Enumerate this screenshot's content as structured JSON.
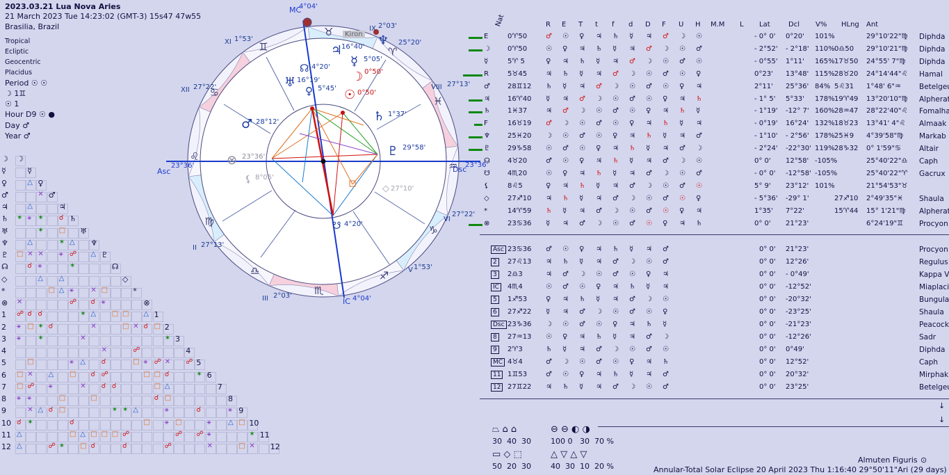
{
  "header": {
    "title": "2023.03.21 Lua Nova Aries",
    "datetime": "21 March 2023  Tue  14:23:02 (GMT-3) 15s47  47w55",
    "place": "Brasilia, Brazil"
  },
  "options": [
    "Tropical",
    "Ecliptic",
    "Geocentric",
    "Placidus"
  ],
  "period": {
    "label": "Period",
    "values": [
      "☉",
      "☉"
    ]
  },
  "moon_line": "☽  1♊",
  "sun_line": "☉   1",
  "hour": {
    "label": "Hour D9",
    "values": [
      "☉",
      "●"
    ]
  },
  "day": {
    "label": "Day",
    "value": "♂"
  },
  "year": {
    "label": "Year",
    "value": "♂"
  },
  "chart": {
    "houses": {
      "mc": "MC",
      "mc_deg": "4°04'",
      "asc": "Asc",
      "asc_deg": "23°36'",
      "dsc": "Dsc",
      "dsc_deg": "23°36'",
      "ic": "IC",
      "ic_deg": "4°04'",
      "cusps": [
        {
          "num": "XI",
          "deg": "1°53'"
        },
        {
          "num": "XII",
          "deg": "27°22'"
        },
        {
          "num": "II",
          "deg": "27°13'"
        },
        {
          "num": "III",
          "deg": "2°03'"
        },
        {
          "num": "VIII",
          "deg": "27°13'"
        },
        {
          "num": "IX",
          "deg": "2°03'"
        },
        {
          "num": "V",
          "deg": "1°53'"
        },
        {
          "num": "VI",
          "deg": "27°22'"
        }
      ]
    },
    "planets": [
      {
        "glyph": "♆",
        "deg": "25°20'",
        "color": "#1a3aa0"
      },
      {
        "glyph": "♃",
        "deg": "16°40'",
        "color": "#1a3aa0"
      },
      {
        "glyph": "☿",
        "deg": "5°05'",
        "color": "#1a3aa0"
      },
      {
        "glyph": "☽",
        "deg": "0°50'",
        "color": "#c81010"
      },
      {
        "glyph": "☉",
        "deg": "0°50'",
        "color": "#c81010"
      },
      {
        "glyph": "♄",
        "deg": "1°37'",
        "color": "#1a3aa0"
      },
      {
        "glyph": "♇",
        "deg": "29°58'",
        "color": "#1a3aa0"
      },
      {
        "glyph": "♅",
        "deg": "16°19'",
        "color": "#1a3aa0"
      },
      {
        "glyph": "♀",
        "deg": "5°45'",
        "color": "#1a3aa0"
      },
      {
        "glyph": "☊",
        "deg": "4°20'",
        "color": "#1a3aa0"
      },
      {
        "glyph": "♂",
        "deg": "28°12'",
        "color": "#1a3aa0"
      },
      {
        "glyph": "⊗",
        "deg": "23°36'",
        "color": "#8a8a9a"
      },
      {
        "glyph": "⚸",
        "deg": "8°05'",
        "color": "#a0a0b0"
      },
      {
        "glyph": "◇",
        "deg": "27°10'",
        "color": "#a0a0b0"
      },
      {
        "glyph": "☋",
        "deg": "4°20'",
        "color": "#1a3aa0"
      }
    ],
    "kiron": "Kiron"
  },
  "table_headers": [
    "Nat",
    "R",
    "E",
    "T",
    "t",
    "f",
    "d",
    "D",
    "F",
    "U",
    "H",
    "M.M",
    "L",
    "Lat",
    "Dcl",
    "V%",
    "HLng",
    "Ant"
  ],
  "rows": [
    {
      "p": "E",
      "pos": "0♈50",
      "lat": "- 0° 0'",
      "dcl": "0°20'",
      "v": "101%",
      "h": "",
      "ant": "29°10'22\"♍",
      "star": "Diphda"
    },
    {
      "p": "☽",
      "pos": "0♈50",
      "lat": "- 2°52'",
      "dcl": "- 2°18'",
      "v": "110%",
      "h": "0♎50",
      "ant": "29°10'21\"♍",
      "star": "Diphda"
    },
    {
      "p": "☿",
      "pos": "5♈ 5",
      "lat": "- 0°55'",
      "dcl": "1°11'",
      "v": "165%",
      "h": "17♉50",
      "ant": "24°55' 7\"♍",
      "star": "Diphda"
    },
    {
      "p": "R",
      "pos": "5♉45",
      "lat": "0°23'",
      "dcl": "13°48'",
      "v": "115%",
      "h": "28♉20",
      "ant": "24°14'44\"♌",
      "star": "Hamal"
    },
    {
      "p": "♂",
      "pos": "28♊12",
      "lat": "2°11'",
      "dcl": "25°36'",
      "v": "84%",
      "h": "5♌31",
      "ant": "1°48' 6\"♒",
      "star": "Betelgeuse"
    },
    {
      "p": "♃",
      "pos": "16♈40",
      "lat": "- 1° 5'",
      "dcl": "5°33'",
      "v": "178%",
      "h": "19♈49",
      "ant": "13°20'10\"♍",
      "star": "Alpheratz"
    },
    {
      "p": "♄",
      "pos": "1♓37",
      "lat": "- 1°19'",
      "dcl": "-12° 7'",
      "v": "160%",
      "h": "28♒47",
      "ant": "28°22'40\"♌",
      "star": "Fomalhaut"
    },
    {
      "p": "F",
      "pos": "16♉19",
      "lat": "- 0°19'",
      "dcl": "16°24'",
      "v": "132%",
      "h": "18♉23",
      "ant": "13°41' 4\"♌",
      "star": "Almaak"
    },
    {
      "p": "♆",
      "pos": "25♓20",
      "lat": "- 1°10'",
      "dcl": "- 2°56'",
      "v": "178%",
      "h": "25♓9",
      "ant": "4°39'58\"♍",
      "star": "Markab"
    },
    {
      "p": "♇",
      "pos": "29♑58",
      "lat": "- 2°24'",
      "dcl": "-22°30'",
      "v": "119%",
      "h": "28♑32",
      "ant": "0° 1'59\"♋",
      "star": "Altair"
    },
    {
      "p": "☊",
      "pos": "4♉20",
      "lat": "0° 0'",
      "dcl": "12°58'",
      "v": "-105%",
      "h": "",
      "ant": "25°40'22\"♎",
      "star": "Caph"
    },
    {
      "p": "☋",
      "pos": "4♏20",
      "lat": "- 0° 0'",
      "dcl": "-12°58'",
      "v": "-105%",
      "h": "",
      "ant": "25°40'22\"♈",
      "star": "Gacrux"
    },
    {
      "p": "⚸",
      "pos": "8♌5",
      "lat": "5° 9'",
      "dcl": "23°12'",
      "v": "101%",
      "h": "",
      "ant": "21°54'53\"♉",
      "star": ""
    },
    {
      "p": "◇",
      "pos": "27♐10",
      "lat": "- 5°36'",
      "dcl": "-29° 1'",
      "v": "",
      "h": "27♐10",
      "ant": "2°49'35\"♓",
      "star": "Shaula"
    },
    {
      "p": "*",
      "pos": "14♈59",
      "lat": "1°35'",
      "dcl": "7°22'",
      "v": "",
      "h": "15♈44",
      "ant": "15° 1'21\"♍",
      "star": "Alpheratz"
    },
    {
      "p": "⊗",
      "pos": "23♋36",
      "lat": "0° 0'",
      "dcl": "21°23'",
      "v": "",
      "h": "",
      "ant": "6°24'19\"♊",
      "star": "Procyon"
    }
  ],
  "house_rows": [
    {
      "p": "Asc",
      "pos": "23♋36",
      "lat": "0° 0'",
      "dcl": "21°23'",
      "star": "Procyon"
    },
    {
      "p": "2",
      "pos": "27♌13",
      "lat": "0° 0'",
      "dcl": "12°26'",
      "star": "Regulus"
    },
    {
      "p": "3",
      "pos": "2♎3",
      "lat": "0° 0'",
      "dcl": "- 0°49'",
      "star": "Kappa Velorum"
    },
    {
      "p": "IC",
      "pos": "4♏4",
      "lat": "0° 0'",
      "dcl": "-12°52'",
      "star": "Miaplacidus"
    },
    {
      "p": "5",
      "pos": "1♐53",
      "lat": "0° 0'",
      "dcl": "-20°32'",
      "star": "Bungula"
    },
    {
      "p": "6",
      "pos": "27♐22",
      "lat": "0° 0'",
      "dcl": "-23°25'",
      "star": "Shaula"
    },
    {
      "p": "Dsc",
      "pos": "23♑36",
      "lat": "0° 0'",
      "dcl": "-21°23'",
      "star": "Peacock"
    },
    {
      "p": "8",
      "pos": "27♒13",
      "lat": "0° 0'",
      "dcl": "-12°26'",
      "star": "Sadr"
    },
    {
      "p": "9",
      "pos": "2♈3",
      "lat": "0° 0'",
      "dcl": "0°49'",
      "star": "Diphda"
    },
    {
      "p": "MC",
      "pos": "4♉4",
      "lat": "0° 0'",
      "dcl": "12°52'",
      "star": "Caph"
    },
    {
      "p": "11",
      "pos": "1♊53",
      "lat": "0° 0'",
      "dcl": "20°32'",
      "star": "Mirphak"
    },
    {
      "p": "12",
      "pos": "27♊22",
      "lat": "0° 0'",
      "dcl": "23°25'",
      "star": "Betelgeuse"
    }
  ],
  "stats": {
    "row1": [
      "30",
      "40",
      "30"
    ],
    "row2": [
      "50",
      "20",
      "30"
    ],
    "row1b": [
      "100",
      "0",
      "30",
      "70 %"
    ],
    "row2b": [
      "40",
      "30",
      "10",
      "20 %"
    ]
  },
  "almuten": "Almuten Figuris",
  "eclipse": "Annular-Total Solar Eclipse 20 April 2023 Thu  1:16:40 29°50'11\"Ari (29 days)"
}
